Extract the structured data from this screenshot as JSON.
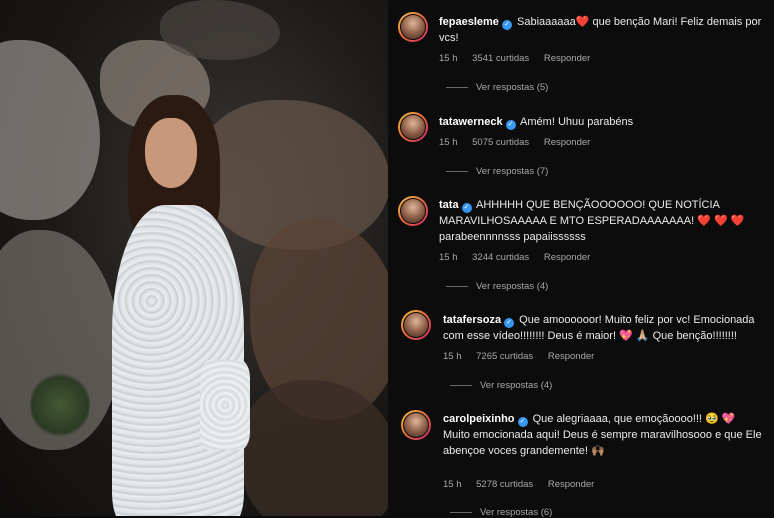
{
  "comments": [
    {
      "username": "fepaesleme",
      "text_before": "Sabiaaaaaa",
      "emoji1": "❤️",
      "text_after": "que benção Mari! Feliz demais por vcs!",
      "time": "15 h",
      "likes": "3541 curtidas",
      "reply": "Responder",
      "view_replies": "Ver respostas (5)"
    },
    {
      "username": "tatawerneck",
      "text_before": "Amém! Uhuu parabéns",
      "emoji1": "",
      "text_after": "",
      "time": "15 h",
      "likes": "5075 curtidas",
      "reply": "Responder",
      "view_replies": "Ver respostas (7)"
    },
    {
      "username": "tata",
      "text_before": "AHHHHH QUE BENÇÃOOOOOO! QUE NOTÍCIA MARAVILHOSAAAAA E MTO ESPERADAAAAAAA!",
      "emoji1": "❤️ ❤️ ❤️",
      "text_after": "parabeennnnsss papaiissssss",
      "time": "15 h",
      "likes": "3244 curtidas",
      "reply": "Responder",
      "view_replies": "Ver respostas (4)"
    },
    {
      "username": "tatafersoza",
      "text_before": "Que amoooooor! Muito feliz por vc! Emocionada com esse vídeo!!!!!!!! Deus é maior!",
      "emoji1": "💖 🙏🏼",
      "text_after": "Que benção!!!!!!!!",
      "time": "15 h",
      "likes": "7265 curtidas",
      "reply": "Responder",
      "view_replies": "Ver respostas (4)"
    },
    {
      "username": "carolpeixinho",
      "text_before": "Que alegriaaaa, que emoçãoooo!!!",
      "emoji1": "🥹 💖",
      "text_after": "Muito emocionada aqui! Deus é sempre maravilhosooo e que Ele abençoe voces grandemente!",
      "emoji2": "🙌🏽",
      "time": "15 h",
      "likes": "5278 curtidas",
      "reply": "Responder",
      "view_replies": "Ver respostas (6)"
    }
  ]
}
